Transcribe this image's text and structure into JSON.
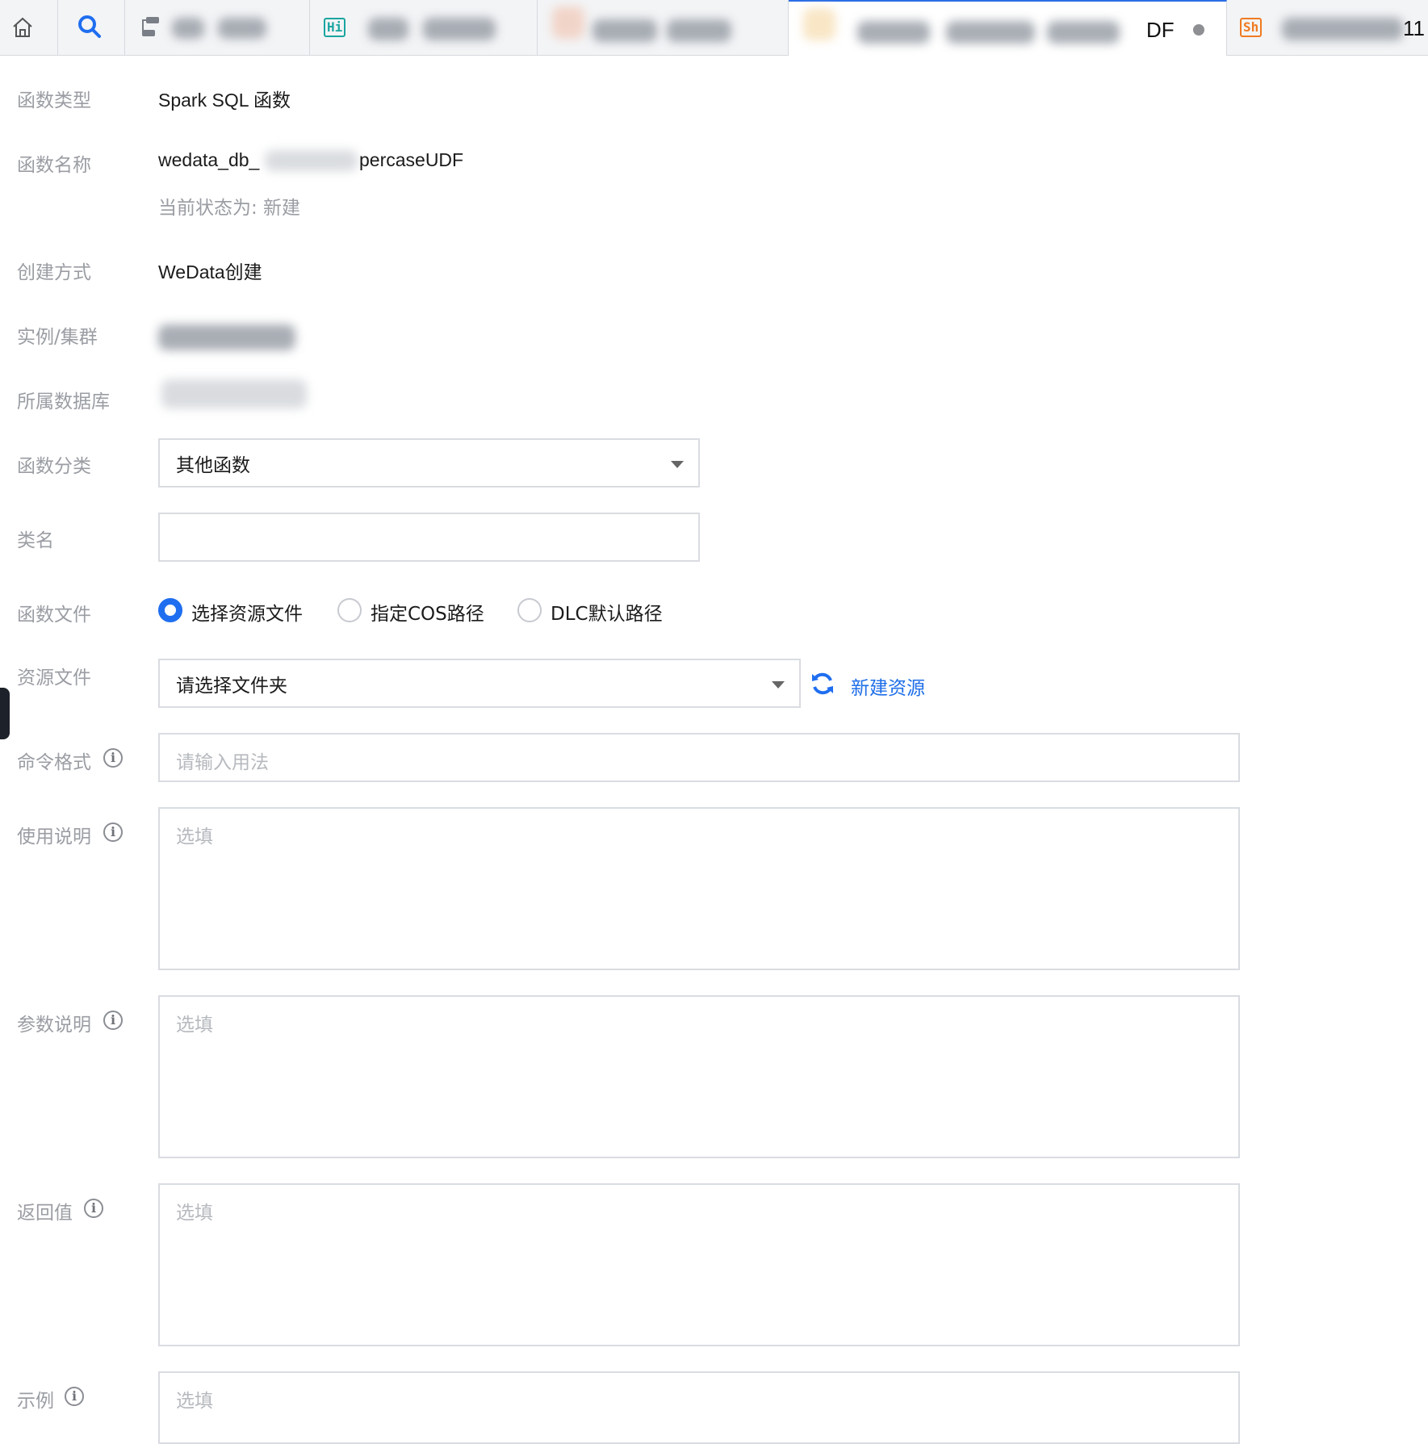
{
  "tabs": {
    "tab4_suffix": "DF",
    "tab5_badge": "Sh",
    "tab5_suffix": "11"
  },
  "form": {
    "function_type": {
      "label": "函数类型",
      "value": "Spark SQL 函数"
    },
    "function_name": {
      "label": "函数名称",
      "value_prefix": "wedata_db_",
      "value_suffix": "percaseUDF",
      "status": "当前状态为: 新建"
    },
    "creation_method": {
      "label": "创建方式",
      "value": "WeData创建"
    },
    "instance_cluster": {
      "label": "实例/集群"
    },
    "database": {
      "label": "所属数据库"
    },
    "category": {
      "label": "函数分类",
      "selected": "其他函数"
    },
    "class_name": {
      "label": "类名",
      "value": ""
    },
    "function_file": {
      "label": "函数文件",
      "options": [
        "选择资源文件",
        "指定COS路径",
        "DLC默认路径"
      ],
      "selected_index": 0
    },
    "resource_file": {
      "label": "资源文件",
      "placeholder": "请选择文件夹",
      "new_resource_label": "新建资源"
    },
    "command_format": {
      "label": "命令格式",
      "placeholder": "请输入用法"
    },
    "usage": {
      "label": "使用说明",
      "placeholder": "选填"
    },
    "params": {
      "label": "参数说明",
      "placeholder": "选填"
    },
    "return_value": {
      "label": "返回值",
      "placeholder": "选填"
    },
    "example": {
      "label": "示例",
      "placeholder": "选填"
    }
  },
  "colors": {
    "accent": "#1f6ef0",
    "label": "#9a9da3",
    "border": "#d9dce1"
  },
  "icons": [
    "home-icon",
    "search-icon",
    "workflow-icon",
    "hive-badge-icon",
    "shell-badge-icon",
    "refresh-icon",
    "info-icon"
  ]
}
